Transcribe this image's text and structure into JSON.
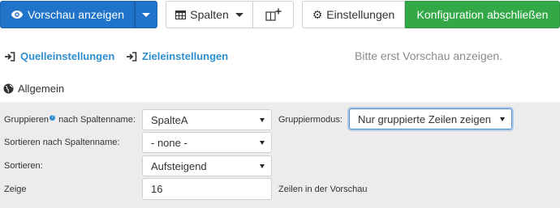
{
  "toolbar": {
    "preview_label": "Vorschau anzeigen",
    "columns_label": "Spalten",
    "settings_label": "Einstellungen",
    "finish_label": "Konfiguration abschließen"
  },
  "links": {
    "source_settings": "Quelleinstellungen",
    "target_settings": "Zieleinstellungen"
  },
  "preview_hint": "Bitte erst Vorschau anzeigen.",
  "section_title": "Allgemein",
  "form": {
    "group_label_pre": "Gruppieren",
    "group_help_icon": "?",
    "group_label_post": " nach Spaltenname:",
    "group_value": "SpalteA",
    "group_mode_label": "Gruppiermodus:",
    "group_mode_value": "Nur gruppierte Zeilen zeigen",
    "sort_by_label": "Sortieren nach Spaltenname:",
    "sort_by_value": "- none -",
    "sort_label": "Sortieren:",
    "sort_value": "Aufsteigend",
    "show_label": "Zeige",
    "show_value": "16",
    "show_suffix": "Zeilen in der Vorschau"
  },
  "colors": {
    "primary": "#1f73c9",
    "success": "#32a847",
    "link": "#2f8fce",
    "panel_bg": "#ececec"
  },
  "icons": {
    "preview": "eye-icon",
    "columns": "table-icon",
    "add_column": "add-column-icon",
    "settings": "gear-icon",
    "source": "sign-in-icon",
    "target": "sign-in-icon",
    "section": "globe-icon"
  }
}
